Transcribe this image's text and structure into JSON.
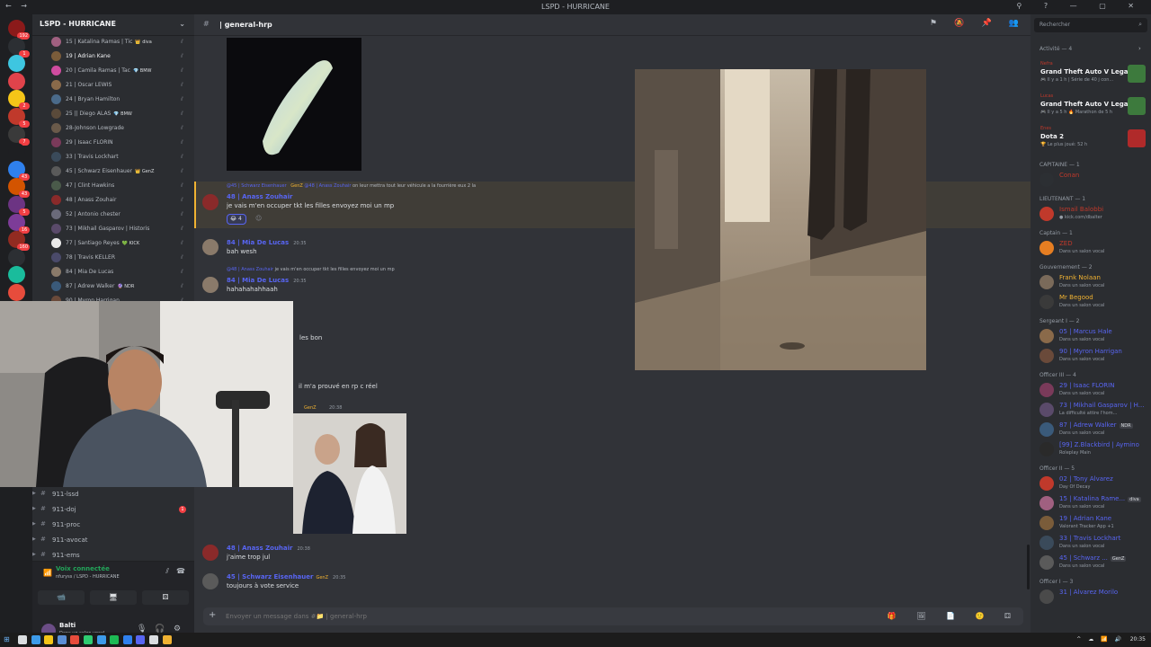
{
  "window": {
    "title": "LSPD - HURRICANE",
    "nav": "← →",
    "controls": "⚲ ? — ▢ ✕"
  },
  "rail": {
    "servers": [
      {
        "color": "#8b1a1a",
        "badge": "192"
      },
      {
        "color": "#2c2f33",
        "badge": "1"
      },
      {
        "color": "#3ec6e0",
        "badge": ""
      },
      {
        "color": "#e0434b",
        "badge": ""
      },
      {
        "color": "#f5c518",
        "badge": "2"
      },
      {
        "color": "#c0392b",
        "badge": "5"
      },
      {
        "color": "#3a3a3a",
        "badge": "7"
      },
      {
        "color": "#1e1f22",
        "badge": ""
      },
      {
        "color": "#2f80ed",
        "badge": "43"
      },
      {
        "color": "#d35400",
        "badge": "43"
      },
      {
        "color": "#6c3483",
        "badge": "5"
      },
      {
        "color": "#7d3c98",
        "badge": "16"
      },
      {
        "color": "#922b21",
        "badge": "160"
      },
      {
        "color": "#2c2f33",
        "badge": ""
      },
      {
        "color": "#1abc9c",
        "badge": ""
      },
      {
        "color": "#e74c3c",
        "badge": ""
      }
    ]
  },
  "sidebar": {
    "server_name": "LSPD - HURRICANE",
    "members": [
      {
        "name": "15 | Katalina Ramas | Tic",
        "badge": "👑 diva",
        "color": "#b5bac1",
        "av": "#a06080"
      },
      {
        "name": "19 | Adrian Kane",
        "badge": "",
        "color": "#f2f3f5",
        "av": "#7a5c3a"
      },
      {
        "name": "20 | Camila Ramas | Tac",
        "badge": "💎 BMW",
        "color": "#b5bac1",
        "av": "#d04ca0"
      },
      {
        "name": "21 | Oscar LEWIS",
        "badge": "",
        "color": "#b5bac1",
        "av": "#8a6a4a"
      },
      {
        "name": "24 | Bryan Hamilton",
        "badge": "",
        "color": "#b5bac1",
        "av": "#4a6a8a"
      },
      {
        "name": "25 || Diego ALAS",
        "badge": "💎 BMW",
        "color": "#b5bac1",
        "av": "#5a4a3a"
      },
      {
        "name": "28-Johnson Lowgrade",
        "badge": "",
        "color": "#b5bac1",
        "av": "#6a5a4a"
      },
      {
        "name": "29 | Isaac FLORIN",
        "badge": "",
        "color": "#b5bac1",
        "av": "#7a3a5a"
      },
      {
        "name": "33 | Travis Lockhart",
        "badge": "",
        "color": "#b5bac1",
        "av": "#3a4a5a"
      },
      {
        "name": "45 | Schwarz Eisenhauer",
        "badge": "👑 GenZ",
        "color": "#b5bac1",
        "av": "#5a5a5a"
      },
      {
        "name": "47 | Clint Hawkins",
        "badge": "",
        "color": "#b5bac1",
        "av": "#4a5a4a"
      },
      {
        "name": "48 | Anass Zouhair",
        "badge": "",
        "color": "#b5bac1",
        "av": "#8a2a2a"
      },
      {
        "name": "52 | Antonio chester",
        "badge": "",
        "color": "#b5bac1",
        "av": "#6a6a7a"
      },
      {
        "name": "73 | Mikhail Gasparov | Historis",
        "badge": "",
        "color": "#b5bac1",
        "av": "#5a4a6a"
      },
      {
        "name": "77 | Santiago Reyes",
        "badge": "💚 KICK",
        "color": "#b5bac1",
        "av": "#eaeaea"
      },
      {
        "name": "78 | Travis KELLER",
        "badge": "",
        "color": "#b5bac1",
        "av": "#4a4a6a"
      },
      {
        "name": "84 | Mia De Lucas",
        "badge": "",
        "color": "#b5bac1",
        "av": "#8a7a6a"
      },
      {
        "name": "87 | Adrew Walker",
        "badge": "🔮 NDR",
        "color": "#b5bac1",
        "av": "#3a5a7a"
      },
      {
        "name": "90 | Myron Harrigan",
        "badge": "",
        "color": "#b5bac1",
        "av": "#6a4a3a"
      }
    ],
    "channels": [
      {
        "label": "911-lssd",
        "ping": ""
      },
      {
        "label": "911-doj",
        "ping": "1"
      },
      {
        "label": "911-proc",
        "ping": ""
      },
      {
        "label": "911-avocat",
        "ping": ""
      },
      {
        "label": "911-ems",
        "ping": ""
      }
    ],
    "voice": {
      "status": "Voix connectée",
      "location": "nfuryss / LSPD - HURRICANE",
      "btn1": "📹",
      "btn2": "🖥",
      "btn3": "⚄"
    },
    "user": {
      "name": "Balti",
      "status": "Dans un salon vocal",
      "mic": "🎙",
      "headset": "🎧",
      "settings": "⚙"
    }
  },
  "main": {
    "channel_name": "| general-hrp",
    "header_tools": "⚑ 🔕 📌 👥",
    "messages": [
      {
        "type": "reply",
        "reply_author": "@45 | Schwarz Eisenhauer",
        "reply_badge": "GenZ",
        "reply_to": "@48 | Anass Zouhair",
        "reply_text": "on leur mettra tout leur véhicule a la fourrière eux 2 la",
        "author": "48 | Anass Zouhair",
        "author_color": "#5865f2",
        "time": "",
        "text": "je vais m'en occuper tkt les filles envoyez moi un mp",
        "av": "#8a2a2a"
      },
      {
        "author": "84 | Mia De Lucas",
        "author_color": "#5865f2",
        "time": "20:35",
        "text": "bah wesh",
        "av": "#8a7a6a"
      },
      {
        "type": "reply",
        "reply_author": "@48 | Anass Zouhair",
        "reply_text": "je vais m'en occuper tkt les filles envoyez moi un mp",
        "author": "84 | Mia De Lucas",
        "author_color": "#5865f2",
        "time": "20:35",
        "text": "hahahahahhaah",
        "av": "#8a7a6a"
      },
      {
        "text": "les bon"
      },
      {
        "text": "il m'a prouvé en rp c réel"
      },
      {
        "author": "48 | Anass Zouhair",
        "author_color": "#5865f2",
        "time": "20:38",
        "text": "j'aime trop jul",
        "av": "#8a2a2a"
      },
      {
        "author": "45 | Schwarz Eisenhauer",
        "author_color": "#5865f2",
        "badge": "GenZ",
        "time": "20:35",
        "text": "toujours à vote service",
        "av": "#5a5a5a"
      }
    ],
    "reaction": {
      "emoji": "😂",
      "count": "4"
    },
    "partial_author_badge": "GenZ",
    "partial_time": "20:38",
    "composer_placeholder": "Envoyer un message dans #📁 | general-hrp",
    "composer_icons": "🎁 🖼 📄 🙂 ⚃"
  },
  "right": {
    "search_placeholder": "Rechercher",
    "activity_header": "Activité — 4",
    "activities": [
      {
        "who": "Nefra",
        "game": "Grand Theft Auto V Legacy",
        "detail": "🎮 Il y a 1 h  |  Série de 40 j con...",
        "color": "#3d7a3d"
      },
      {
        "who": "Lucas",
        "game": "Grand Theft Auto V Legacy",
        "detail": "🎮 Il y a 5 h  🔥 Marathon de 5 h",
        "color": "#3d7a3d"
      },
      {
        "who": "Enes",
        "game": "Dota 2",
        "detail": "🏆 Le plus joué: 52 h",
        "color": "#b02a2a"
      }
    ],
    "sections": [
      {
        "title": "CAPITAINE — 1",
        "members": [
          {
            "name": "Conan",
            "status": "",
            "color": "#c0392b",
            "av": "#2c2f33"
          }
        ]
      },
      {
        "title": "LIEUTENANT — 1",
        "members": [
          {
            "name": "Ismail Balobbi",
            "status": "● kick.com/dbalter",
            "color": "#c0392b",
            "av": "#c0392b"
          }
        ]
      },
      {
        "title": "Captain — 1",
        "members": [
          {
            "name": "ZED",
            "status": "Dans un salon vocal",
            "color": "#c0392b",
            "av": "#e67e22"
          }
        ]
      },
      {
        "title": "Gouvernement — 2",
        "members": [
          {
            "name": "Frank Nolaan",
            "status": "Dans un salon vocal",
            "color": "#f0b232",
            "av": "#7a6a5a"
          },
          {
            "name": "Mr Begood",
            "status": "Dans un salon vocal",
            "color": "#f0b232",
            "av": "#3a3a3a"
          }
        ]
      },
      {
        "title": "Sergeant I — 2",
        "members": [
          {
            "name": "05 | Marcus Hale",
            "status": "Dans un salon vocal",
            "color": "#5865f2",
            "av": "#8a6a4a"
          },
          {
            "name": "90 | Myron Harrigan",
            "status": "Dans un salon vocal",
            "color": "#5865f2",
            "av": "#6a4a3a"
          }
        ]
      },
      {
        "title": "Officer III — 4",
        "members": [
          {
            "name": "29 | Isaac FLORIN",
            "status": "Dans un salon vocal",
            "color": "#5865f2",
            "av": "#7a3a5a",
            "badge": ""
          },
          {
            "name": "73 | Mikhail Gasparov | H...",
            "status": "La difficulté attire l'hom...",
            "color": "#5865f2",
            "av": "#5a4a6a",
            "badge": ""
          },
          {
            "name": "87 | Adrew Walker",
            "status": "Dans un salon vocal",
            "color": "#5865f2",
            "av": "#3a5a7a",
            "badge": "NDR"
          },
          {
            "name": "[99] Z.Blackbird | Aymino",
            "status": "Roleplay Main",
            "color": "#5865f2",
            "av": "#2a2a2a",
            "badge": ""
          }
        ]
      },
      {
        "title": "Officer II — 5",
        "members": [
          {
            "name": "02 | Tony Alvarez",
            "status": "Day Of Decay",
            "color": "#5865f2",
            "av": "#c0392b",
            "badge": ""
          },
          {
            "name": "15 | Katalina Rame...",
            "status": "Dans un salon vocal",
            "color": "#5865f2",
            "av": "#a06080",
            "badge": "diva"
          },
          {
            "name": "19 | Adrian Kane",
            "status": "Valorant Tracker App +1",
            "color": "#5865f2",
            "av": "#7a5c3a",
            "badge": ""
          },
          {
            "name": "33 | Travis Lockhart",
            "status": "Dans un salon vocal",
            "color": "#5865f2",
            "av": "#3a4a5a",
            "badge": ""
          },
          {
            "name": "45 | Schwarz ...",
            "status": "Dans un salon vocal",
            "color": "#5865f2",
            "av": "#5a5a5a",
            "badge": "GenZ"
          }
        ]
      },
      {
        "title": "Officer I — 3",
        "members": [
          {
            "name": "31 | Alvarez Morilo",
            "status": "",
            "color": "#5865f2",
            "av": "#4a4a4a",
            "badge": ""
          }
        ]
      }
    ]
  },
  "taskbar": {
    "tray": "^ ☁ 📶 🔊",
    "clock": "20:35"
  }
}
